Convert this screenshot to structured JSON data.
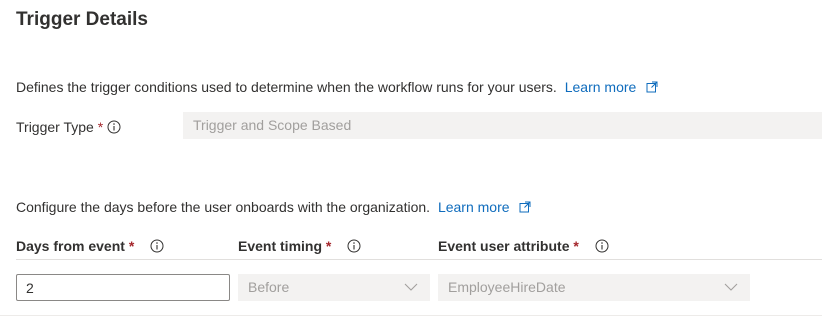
{
  "section": {
    "title": "Trigger Details"
  },
  "trigger": {
    "description": "Defines the trigger conditions used to determine when the workflow runs for your users.",
    "learn_more": "Learn more",
    "type_label": "Trigger Type",
    "required_mark": "*",
    "type_value": "Trigger and Scope Based"
  },
  "onboard": {
    "description": "Configure the days before the user onboards with the organization.",
    "learn_more": "Learn more"
  },
  "columns": {
    "days_header": "Days from event",
    "timing_header": "Event timing",
    "attribute_header": "Event user attribute",
    "required_mark": "*"
  },
  "values": {
    "days": "2",
    "timing": "Before",
    "attribute": "EmployeeHireDate"
  },
  "colors": {
    "accent_link": "#0f6cbd",
    "required": "#a4262c",
    "disabled_bg": "#f3f2f1",
    "disabled_text": "#a19f9d"
  },
  "icons": [
    "external-link-icon",
    "info-icon",
    "chevron-down-icon"
  ]
}
